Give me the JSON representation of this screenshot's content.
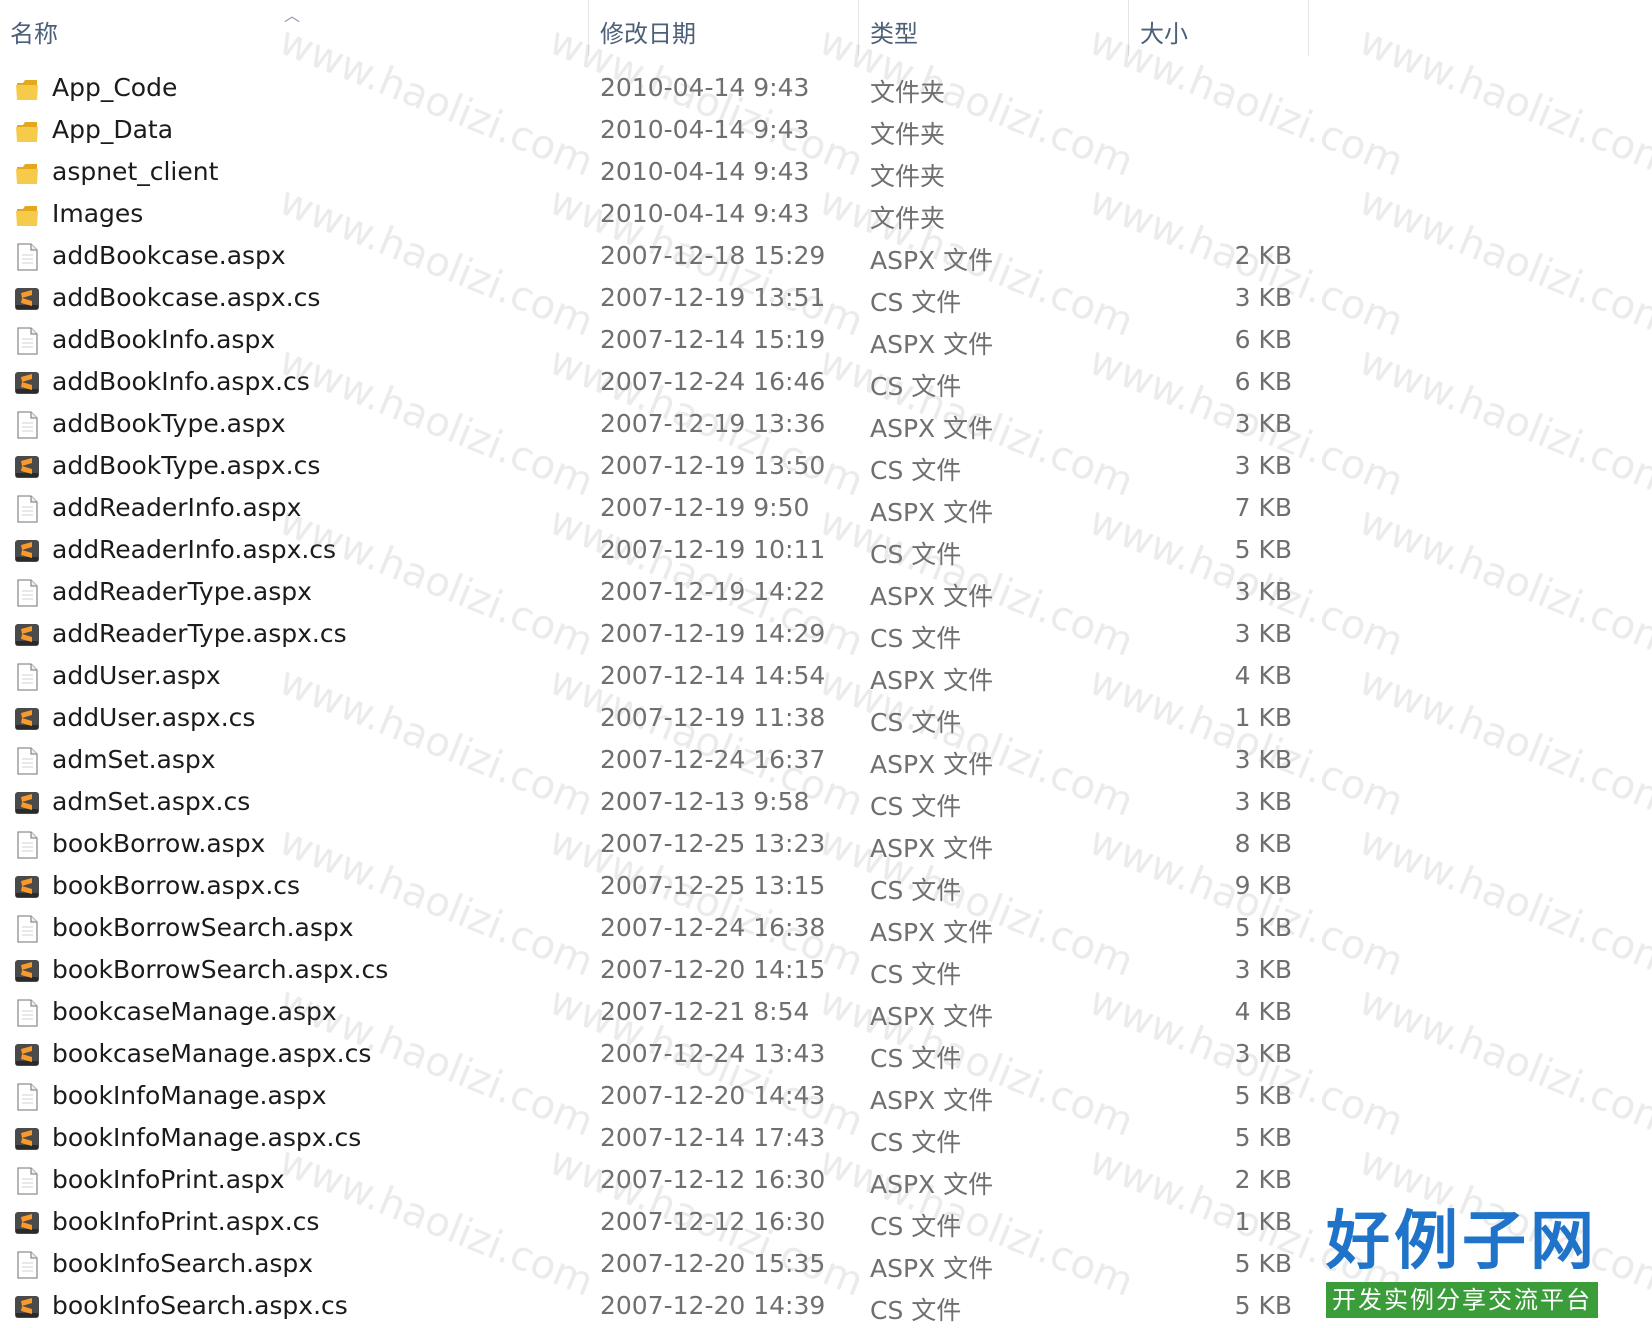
{
  "header": {
    "name": "名称",
    "date": "修改日期",
    "type": "类型",
    "size": "大小"
  },
  "files": [
    {
      "name": "App_Code",
      "date": "2010-04-14 9:43",
      "type": "文件夹",
      "size": "",
      "icon": "folder-icon"
    },
    {
      "name": "App_Data",
      "date": "2010-04-14 9:43",
      "type": "文件夹",
      "size": "",
      "icon": "folder-icon"
    },
    {
      "name": "aspnet_client",
      "date": "2010-04-14 9:43",
      "type": "文件夹",
      "size": "",
      "icon": "folder-icon"
    },
    {
      "name": "Images",
      "date": "2010-04-14 9:43",
      "type": "文件夹",
      "size": "",
      "icon": "folder-icon"
    },
    {
      "name": "addBookcase.aspx",
      "date": "2007-12-18 15:29",
      "type": "ASPX 文件",
      "size": "2 KB",
      "icon": "document-icon"
    },
    {
      "name": "addBookcase.aspx.cs",
      "date": "2007-12-19 13:51",
      "type": "CS 文件",
      "size": "3 KB",
      "icon": "sublime-file-icon"
    },
    {
      "name": "addBookInfo.aspx",
      "date": "2007-12-14 15:19",
      "type": "ASPX 文件",
      "size": "6 KB",
      "icon": "document-icon"
    },
    {
      "name": "addBookInfo.aspx.cs",
      "date": "2007-12-24 16:46",
      "type": "CS 文件",
      "size": "6 KB",
      "icon": "sublime-file-icon"
    },
    {
      "name": "addBookType.aspx",
      "date": "2007-12-19 13:36",
      "type": "ASPX 文件",
      "size": "3 KB",
      "icon": "document-icon"
    },
    {
      "name": "addBookType.aspx.cs",
      "date": "2007-12-19 13:50",
      "type": "CS 文件",
      "size": "3 KB",
      "icon": "sublime-file-icon"
    },
    {
      "name": "addReaderInfo.aspx",
      "date": "2007-12-19 9:50",
      "type": "ASPX 文件",
      "size": "7 KB",
      "icon": "document-icon"
    },
    {
      "name": "addReaderInfo.aspx.cs",
      "date": "2007-12-19 10:11",
      "type": "CS 文件",
      "size": "5 KB",
      "icon": "sublime-file-icon"
    },
    {
      "name": "addReaderType.aspx",
      "date": "2007-12-19 14:22",
      "type": "ASPX 文件",
      "size": "3 KB",
      "icon": "document-icon"
    },
    {
      "name": "addReaderType.aspx.cs",
      "date": "2007-12-19 14:29",
      "type": "CS 文件",
      "size": "3 KB",
      "icon": "sublime-file-icon"
    },
    {
      "name": "addUser.aspx",
      "date": "2007-12-14 14:54",
      "type": "ASPX 文件",
      "size": "4 KB",
      "icon": "document-icon"
    },
    {
      "name": "addUser.aspx.cs",
      "date": "2007-12-19 11:38",
      "type": "CS 文件",
      "size": "1 KB",
      "icon": "sublime-file-icon"
    },
    {
      "name": "admSet.aspx",
      "date": "2007-12-24 16:37",
      "type": "ASPX 文件",
      "size": "3 KB",
      "icon": "document-icon"
    },
    {
      "name": "admSet.aspx.cs",
      "date": "2007-12-13 9:58",
      "type": "CS 文件",
      "size": "3 KB",
      "icon": "sublime-file-icon"
    },
    {
      "name": "bookBorrow.aspx",
      "date": "2007-12-25 13:23",
      "type": "ASPX 文件",
      "size": "8 KB",
      "icon": "document-icon"
    },
    {
      "name": "bookBorrow.aspx.cs",
      "date": "2007-12-25 13:15",
      "type": "CS 文件",
      "size": "9 KB",
      "icon": "sublime-file-icon"
    },
    {
      "name": "bookBorrowSearch.aspx",
      "date": "2007-12-24 16:38",
      "type": "ASPX 文件",
      "size": "5 KB",
      "icon": "document-icon"
    },
    {
      "name": "bookBorrowSearch.aspx.cs",
      "date": "2007-12-20 14:15",
      "type": "CS 文件",
      "size": "3 KB",
      "icon": "sublime-file-icon"
    },
    {
      "name": "bookcaseManage.aspx",
      "date": "2007-12-21 8:54",
      "type": "ASPX 文件",
      "size": "4 KB",
      "icon": "document-icon"
    },
    {
      "name": "bookcaseManage.aspx.cs",
      "date": "2007-12-24 13:43",
      "type": "CS 文件",
      "size": "3 KB",
      "icon": "sublime-file-icon"
    },
    {
      "name": "bookInfoManage.aspx",
      "date": "2007-12-20 14:43",
      "type": "ASPX 文件",
      "size": "5 KB",
      "icon": "document-icon"
    },
    {
      "name": "bookInfoManage.aspx.cs",
      "date": "2007-12-14 17:43",
      "type": "CS 文件",
      "size": "5 KB",
      "icon": "sublime-file-icon"
    },
    {
      "name": "bookInfoPrint.aspx",
      "date": "2007-12-12 16:30",
      "type": "ASPX 文件",
      "size": "2 KB",
      "icon": "document-icon"
    },
    {
      "name": "bookInfoPrint.aspx.cs",
      "date": "2007-12-12 16:30",
      "type": "CS 文件",
      "size": "1 KB",
      "icon": "sublime-file-icon"
    },
    {
      "name": "bookInfoSearch.aspx",
      "date": "2007-12-20 15:35",
      "type": "ASPX 文件",
      "size": "5 KB",
      "icon": "document-icon"
    },
    {
      "name": "bookInfoSearch.aspx.cs",
      "date": "2007-12-20 14:39",
      "type": "CS 文件",
      "size": "5 KB",
      "icon": "sublime-file-icon"
    }
  ],
  "watermark": "www.haolizi.com",
  "logo": {
    "main": "好例子网",
    "sub": "开发实例分享交流平台"
  },
  "colors": {
    "header_text": "#4c607a",
    "meta_text": "#6f6f6f",
    "folder": "#f4c542",
    "logo_blue": "#1f73c8",
    "logo_green": "#3a9d3a"
  }
}
